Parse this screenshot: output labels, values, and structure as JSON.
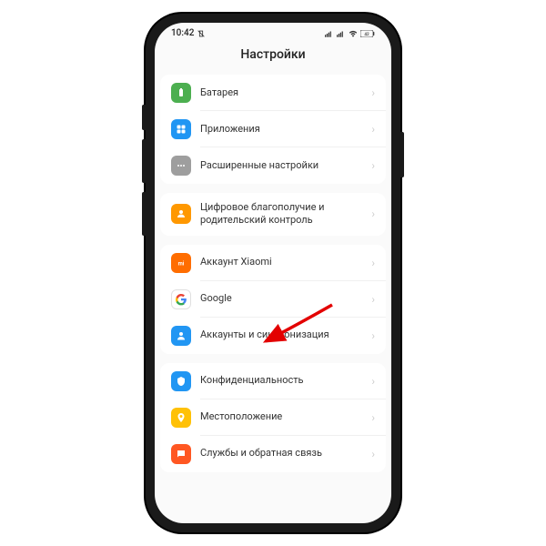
{
  "statusBar": {
    "time": "10:42",
    "batteryPercent": "42"
  },
  "header": {
    "title": "Настройки"
  },
  "sections": [
    {
      "items": [
        {
          "label": "Батарея"
        },
        {
          "label": "Приложения"
        },
        {
          "label": "Расширенные настройки"
        }
      ]
    },
    {
      "items": [
        {
          "label": "Цифровое благополучие и родительский контроль"
        }
      ]
    },
    {
      "items": [
        {
          "label": "Аккаунт Xiaomi"
        },
        {
          "label": "Google"
        },
        {
          "label": "Аккаунты и синхронизация"
        }
      ]
    },
    {
      "items": [
        {
          "label": "Конфиденциальность"
        },
        {
          "label": "Местоположение"
        },
        {
          "label": "Службы и обратная связь"
        }
      ]
    }
  ]
}
